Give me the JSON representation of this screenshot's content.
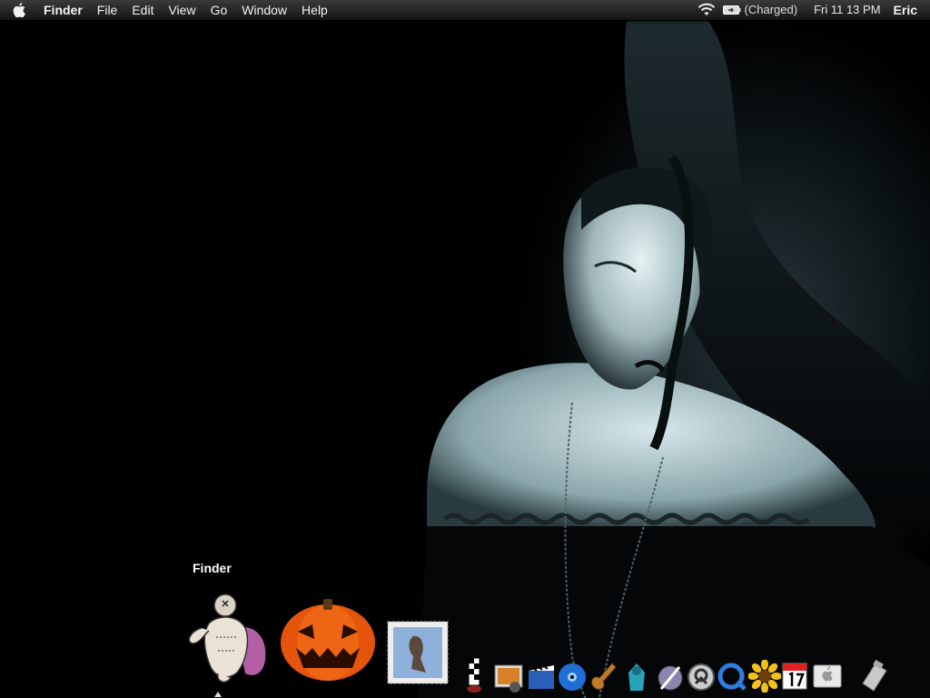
{
  "menubar": {
    "app_name": "Finder",
    "menus": [
      "File",
      "Edit",
      "View",
      "Go",
      "Window",
      "Help"
    ],
    "battery_status": "(Charged)",
    "clock": "Fri 11 13 PM",
    "user": "Eric"
  },
  "dock": {
    "tooltip": "Finder"
  }
}
